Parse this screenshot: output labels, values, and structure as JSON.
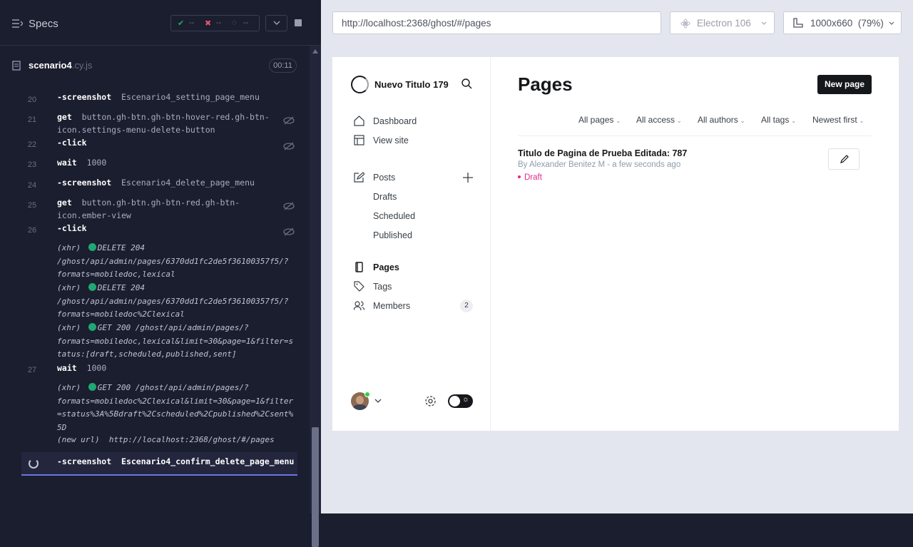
{
  "runner": {
    "header": {
      "title": "Specs",
      "passed": "--",
      "failed": "--",
      "pending": "--"
    },
    "file": {
      "name": "scenario4",
      "ext": ".cy.js",
      "duration": "00:11"
    },
    "log": [
      {
        "num": "20",
        "cmd": "-screenshot",
        "arg": "Escenario4_setting_page_menu"
      },
      {
        "num": "21",
        "cmd": "get",
        "arg": "button.gh-btn.gh-btn-hover-red.gh-btn-",
        "arg2": "icon.settings-menu-delete-button"
      },
      {
        "num": "22",
        "cmd": "-click",
        "arg": ""
      },
      {
        "num": "23",
        "cmd": "wait",
        "arg": "1000"
      },
      {
        "num": "24",
        "cmd": "-screenshot",
        "arg": "Escenario4_delete_page_menu"
      },
      {
        "num": "25",
        "cmd": "get",
        "arg": "button.gh-btn.gh-btn-red.gh-btn-",
        "arg2": "icon.ember-view"
      },
      {
        "num": "26",
        "cmd": "-click",
        "arg": ""
      },
      {
        "num": "27",
        "cmd": "wait",
        "arg": "1000"
      }
    ],
    "xhr1": {
      "prefix": "(xhr)",
      "method": "DELETE 204",
      "l2": "/ghost/api/admin/pages/6370dd1fc2de5f36100357f5/?",
      "l3": "formats=mobiledoc,lexical"
    },
    "xhr2": {
      "prefix": "(xhr)",
      "method": "DELETE 204",
      "l2": "/ghost/api/admin/pages/6370dd1fc2de5f36100357f5/?",
      "l3": "formats=mobiledoc%2Clexical"
    },
    "xhr3": {
      "prefix": "(xhr)",
      "method": "GET 200 /ghost/api/admin/pages/?",
      "l2": "formats=mobiledoc,lexical&limit=30&page=1&filter=s",
      "l3": "tatus:[draft,scheduled,published,sent]"
    },
    "xhr4": {
      "prefix": "(xhr)",
      "method": "GET 200 /ghost/api/admin/pages/?",
      "l2": "formats=mobiledoc%2Clexical&limit=30&page=1&filter",
      "l3": "=status%3A%5Bdraft%2Cscheduled%2Cpublished%2Csent%",
      "l4": "5D"
    },
    "newurl": {
      "prefix": "(new url)",
      "url": "http://localhost:2368/ghost/#/pages"
    },
    "active": {
      "cmd": "-screenshot",
      "arg": "Escenario4_confirm_delete_page_menu"
    }
  },
  "toolbar": {
    "url": "http://localhost:2368/ghost/#/pages",
    "browser": "Electron 106",
    "viewport": "1000x660",
    "zoom": "(79%)"
  },
  "ghost": {
    "site_title": "Nuevo Titulo 179",
    "nav": {
      "dashboard": "Dashboard",
      "view_site": "View site",
      "posts": "Posts",
      "drafts": "Drafts",
      "scheduled": "Scheduled",
      "published": "Published",
      "pages": "Pages",
      "tags": "Tags",
      "members": "Members",
      "members_count": "2"
    },
    "page_title": "Pages",
    "new_page": "New page",
    "filters": {
      "type": "All pages",
      "access": "All access",
      "authors": "All authors",
      "tags": "All tags",
      "sort": "Newest first"
    },
    "item": {
      "title": "Titulo de Pagina de Prueba Editada: 787",
      "meta": "By Alexander Benitez M - a few seconds ago",
      "status": "Draft"
    }
  },
  "colors": {
    "accent": "#15171a",
    "draft": "#e7278c",
    "runner_bg": "#1b1e2e",
    "xhr_dot": "#1fa971"
  }
}
